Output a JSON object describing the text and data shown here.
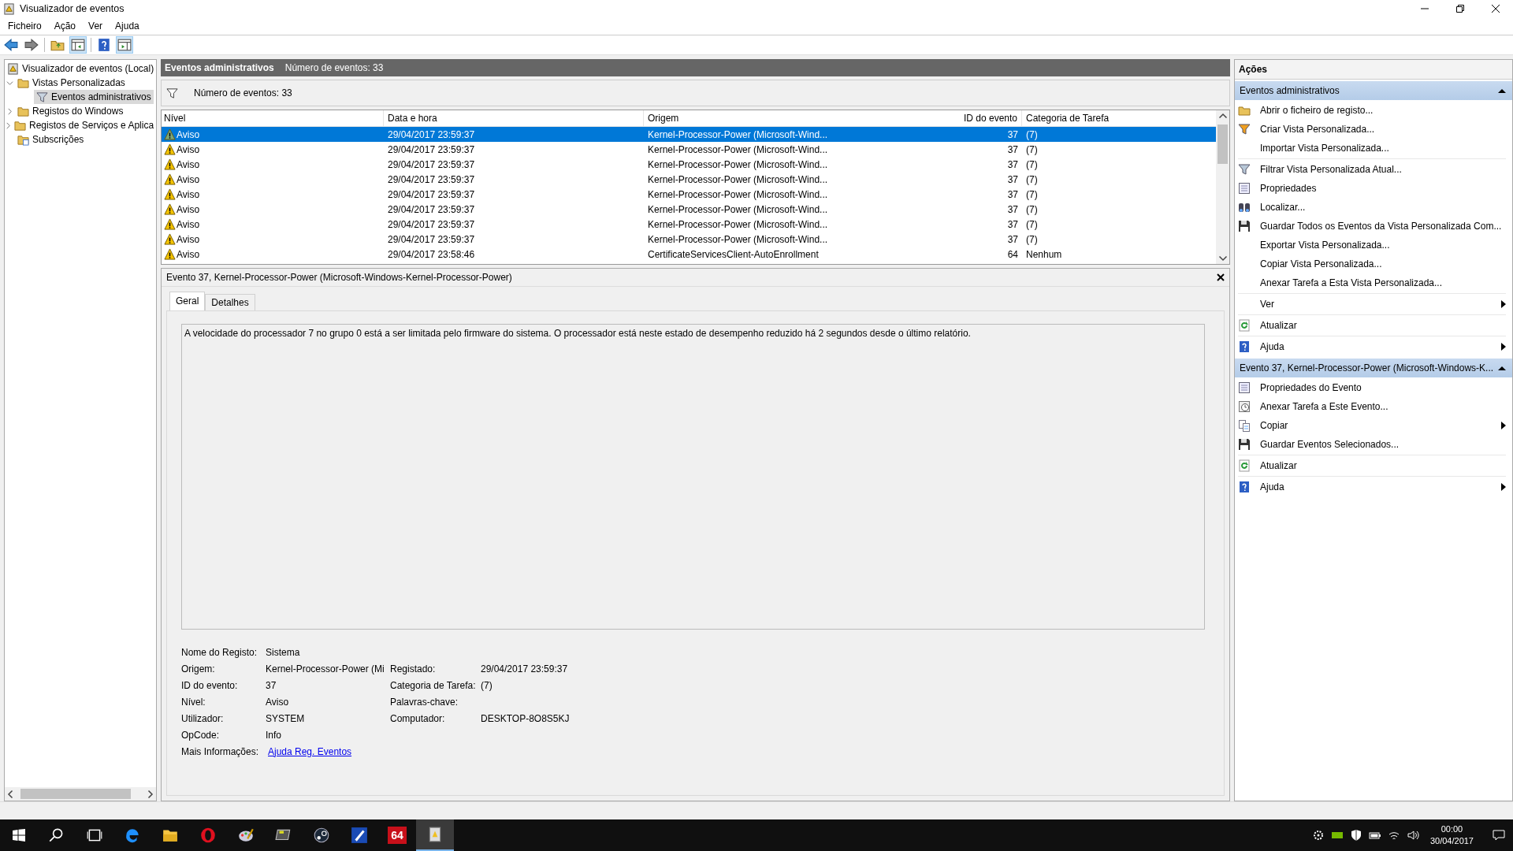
{
  "window": {
    "title": "Visualizador de eventos"
  },
  "menu": [
    "Ficheiro",
    "Ação",
    "Ver",
    "Ajuda"
  ],
  "tree": [
    {
      "label": "Visualizador de eventos (Local)",
      "kind": "root",
      "selected": false,
      "children": [
        {
          "label": "Vistas Personalizadas",
          "kind": "folder",
          "expanded": true,
          "selected": false,
          "children": [
            {
              "label": "Eventos administrativos",
              "kind": "filter",
              "selected": true
            }
          ]
        },
        {
          "label": "Registos do Windows",
          "kind": "folder",
          "expanded": false,
          "selected": false
        },
        {
          "label": "Registos de Serviços e Aplica",
          "kind": "folder",
          "expanded": false,
          "selected": false
        },
        {
          "label": "Subscrições",
          "kind": "subs",
          "selected": false
        }
      ]
    }
  ],
  "header": {
    "title": "Eventos administrativos",
    "count": "Número de eventos: 33"
  },
  "filter_count": "Número de eventos: 33",
  "table": {
    "columns": [
      "Nível",
      "Data e hora",
      "Origem",
      "ID do evento",
      "Categoria de Tarefa"
    ],
    "rows": [
      {
        "level": "Aviso",
        "date": "29/04/2017 23:59:37",
        "origin": "Kernel-Processor-Power (Microsoft-Wind...",
        "id": "37",
        "category": "(7)",
        "selected": true
      },
      {
        "level": "Aviso",
        "date": "29/04/2017 23:59:37",
        "origin": "Kernel-Processor-Power (Microsoft-Wind...",
        "id": "37",
        "category": "(7)",
        "selected": false
      },
      {
        "level": "Aviso",
        "date": "29/04/2017 23:59:37",
        "origin": "Kernel-Processor-Power (Microsoft-Wind...",
        "id": "37",
        "category": "(7)",
        "selected": false
      },
      {
        "level": "Aviso",
        "date": "29/04/2017 23:59:37",
        "origin": "Kernel-Processor-Power (Microsoft-Wind...",
        "id": "37",
        "category": "(7)",
        "selected": false
      },
      {
        "level": "Aviso",
        "date": "29/04/2017 23:59:37",
        "origin": "Kernel-Processor-Power (Microsoft-Wind...",
        "id": "37",
        "category": "(7)",
        "selected": false
      },
      {
        "level": "Aviso",
        "date": "29/04/2017 23:59:37",
        "origin": "Kernel-Processor-Power (Microsoft-Wind...",
        "id": "37",
        "category": "(7)",
        "selected": false
      },
      {
        "level": "Aviso",
        "date": "29/04/2017 23:59:37",
        "origin": "Kernel-Processor-Power (Microsoft-Wind...",
        "id": "37",
        "category": "(7)",
        "selected": false
      },
      {
        "level": "Aviso",
        "date": "29/04/2017 23:59:37",
        "origin": "Kernel-Processor-Power (Microsoft-Wind...",
        "id": "37",
        "category": "(7)",
        "selected": false
      },
      {
        "level": "Aviso",
        "date": "29/04/2017 23:58:46",
        "origin": "CertificateServicesClient-AutoEnrollment",
        "id": "64",
        "category": "Nenhum",
        "selected": false
      }
    ]
  },
  "details": {
    "title": "Evento 37, Kernel-Processor-Power (Microsoft-Windows-Kernel-Processor-Power)",
    "tabs": [
      {
        "label": "Geral",
        "selected": true
      },
      {
        "label": "Detalhes",
        "selected": false
      }
    ],
    "message": "A velocidade do processador 7 no grupo 0 está a ser limitada pelo firmware do sistema. O processador está neste estado de desempenho reduzido há 2 segundos desde o último relatório.",
    "log_name": {
      "label": "Nome do Registo:",
      "value": "Sistema"
    },
    "rows": [
      {
        "label": "Origem:",
        "value": "Kernel-Processor-Power (Mi",
        "label2": "Registado:",
        "value2": "29/04/2017 23:59:37"
      },
      {
        "label": "ID do evento:",
        "value": "37",
        "label2": "Categoria de Tarefa:",
        "value2": "(7)"
      },
      {
        "label": "Nível:",
        "value": "Aviso",
        "label2": "Palavras-chave:"
      },
      {
        "label": "Utilizador:",
        "value": "SYSTEM",
        "label2": "Computador:",
        "value2": "DESKTOP-8O8S5KJ"
      },
      {
        "label": "OpCode:",
        "value": "Info"
      }
    ],
    "more_info": {
      "label": "Mais Informações:",
      "link": "Ajuda Reg. Eventos"
    }
  },
  "actions": {
    "title": "Ações",
    "sections": [
      {
        "title": "Eventos administrativos",
        "expanded": true,
        "groups": [
          [
            {
              "label": "Abrir o ficheiro de registo...",
              "kind": "folder",
              "submenu": false
            },
            {
              "label": "Criar Vista Personalizada...",
              "kind": "funnel-new",
              "submenu": false
            },
            {
              "label": "Importar Vista Personalizada...",
              "kind": "plain",
              "submenu": false
            }
          ],
          [
            {
              "label": "Filtrar Vista Personalizada Atual...",
              "kind": "funnel",
              "submenu": false
            },
            {
              "label": "Propriedades",
              "kind": "props",
              "submenu": false
            },
            {
              "label": "Localizar...",
              "kind": "binoculars",
              "submenu": false
            },
            {
              "label": "Guardar Todos os Eventos da Vista Personalizada Com...",
              "kind": "floppy",
              "submenu": false
            },
            {
              "label": "Exportar Vista Personalizada...",
              "kind": "plain",
              "submenu": false
            },
            {
              "label": "Copiar Vista Personalizada...",
              "kind": "plain",
              "submenu": false
            },
            {
              "label": "Anexar Tarefa a Esta Vista Personalizada...",
              "kind": "plain",
              "submenu": false
            }
          ],
          [
            {
              "label": "Ver",
              "kind": "plain",
              "submenu": true
            }
          ],
          [
            {
              "label": "Atualizar",
              "kind": "refresh",
              "submenu": false
            }
          ],
          [
            {
              "label": "Ajuda",
              "kind": "help",
              "submenu": true
            }
          ]
        ]
      },
      {
        "title": "Evento 37, Kernel-Processor-Power (Microsoft-Windows-K...",
        "expanded": true,
        "groups": [
          [
            {
              "label": "Propriedades do Evento",
              "kind": "props",
              "submenu": false
            },
            {
              "label": "Anexar Tarefa a Este Evento...",
              "kind": "task",
              "submenu": false
            },
            {
              "label": "Copiar",
              "kind": "copy",
              "submenu": true
            },
            {
              "label": "Guardar Eventos Selecionados...",
              "kind": "floppy",
              "submenu": false
            }
          ],
          [
            {
              "label": "Atualizar",
              "kind": "refresh",
              "submenu": false
            }
          ],
          [
            {
              "label": "Ajuda",
              "kind": "help",
              "submenu": true
            }
          ]
        ]
      }
    ]
  },
  "taskbar": {
    "apps": [
      {
        "kind": "search",
        "selected": false
      },
      {
        "kind": "taskview",
        "selected": false
      },
      {
        "kind": "edge",
        "selected": false
      },
      {
        "kind": "explorer",
        "selected": false
      },
      {
        "kind": "opera",
        "selected": false
      },
      {
        "kind": "paint",
        "selected": false
      },
      {
        "kind": "monitor",
        "selected": false
      },
      {
        "kind": "steam",
        "selected": false
      },
      {
        "kind": "pen",
        "selected": false
      },
      {
        "kind": "badge",
        "label": "64",
        "selected": false
      },
      {
        "kind": "eventviewer",
        "selected": true
      }
    ],
    "time": "00:00",
    "date": "30/04/2017"
  }
}
